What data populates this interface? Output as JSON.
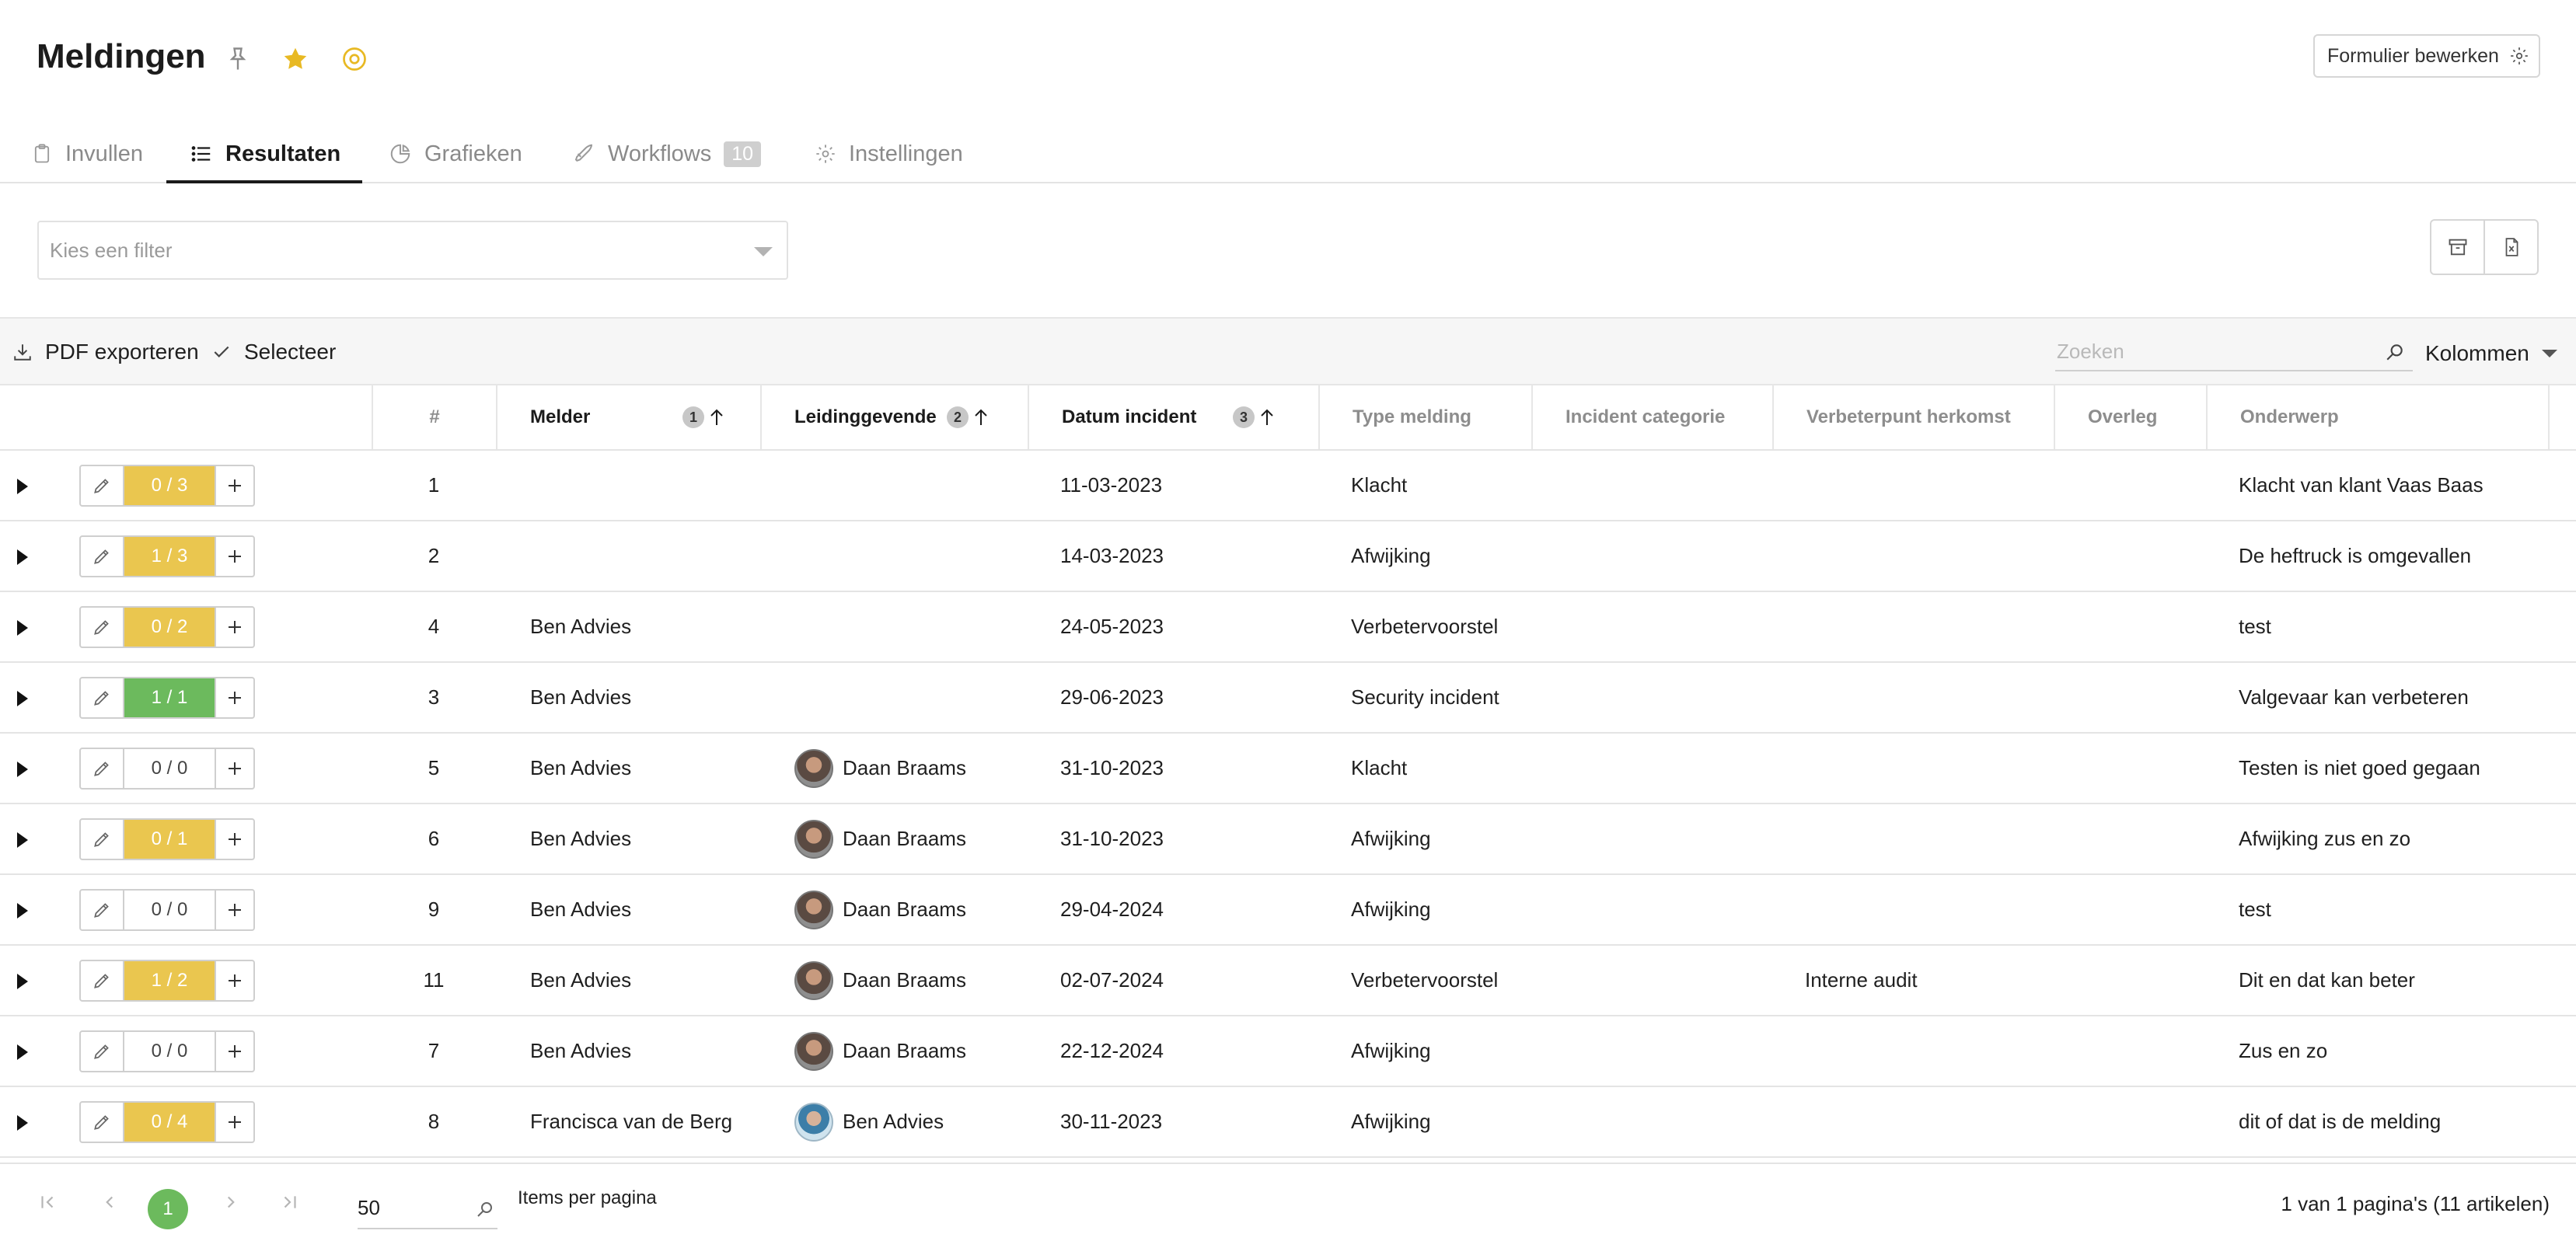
{
  "header": {
    "title": "Meldingen",
    "edit_form_label": "Formulier bewerken"
  },
  "tabs": [
    {
      "label": "Invullen",
      "icon": "clipboard-icon"
    },
    {
      "label": "Resultaten",
      "icon": "list-icon",
      "active": true
    },
    {
      "label": "Grafieken",
      "icon": "chart-pie-icon"
    },
    {
      "label": "Workflows",
      "icon": "rocket-icon",
      "badge": "10"
    },
    {
      "label": "Instellingen",
      "icon": "gear-icon"
    }
  ],
  "filter": {
    "placeholder": "Kies een filter"
  },
  "toolbar": {
    "pdf_label": "PDF exporteren",
    "select_label": "Selecteer",
    "search_placeholder": "Zoeken",
    "columns_label": "Kolommen"
  },
  "columns": {
    "nr": "#",
    "melder": "Melder",
    "melder_sort": "1",
    "leidinggevende": "Leidinggevende",
    "leidinggevende_sort": "2",
    "datum": "Datum incident",
    "datum_sort": "3",
    "type": "Type melding",
    "categorie": "Incident categorie",
    "herkomst": "Verbeterpunt herkomst",
    "overleg": "Overleg",
    "onderwerp": "Onderwerp"
  },
  "rows": [
    {
      "progress": "0 / 3",
      "status": "yellow",
      "nr": "1",
      "melder": "",
      "leidinggevende": "",
      "datum": "11-03-2023",
      "type": "Klacht",
      "herkomst": "",
      "onderwerp": "Klacht van klant Vaas Baas"
    },
    {
      "progress": "1 / 3",
      "status": "yellow",
      "nr": "2",
      "melder": "",
      "leidinggevende": "",
      "datum": "14-03-2023",
      "type": "Afwijking",
      "herkomst": "",
      "onderwerp": "De heftruck is omgevallen"
    },
    {
      "progress": "0 / 2",
      "status": "yellow",
      "nr": "4",
      "melder": "Ben Advies",
      "leidinggevende": "",
      "datum": "24-05-2023",
      "type": "Verbetervoorstel",
      "herkomst": "",
      "onderwerp": "test"
    },
    {
      "progress": "1 / 1",
      "status": "green",
      "nr": "3",
      "melder": "Ben Advies",
      "leidinggevende": "",
      "datum": "29-06-2023",
      "type": "Security incident",
      "herkomst": "",
      "onderwerp": "Valgevaar kan verbeteren"
    },
    {
      "progress": "0 / 0",
      "status": "empty",
      "nr": "5",
      "melder": "Ben Advies",
      "leidinggevende": "Daan Braams",
      "datum": "31-10-2023",
      "type": "Klacht",
      "herkomst": "",
      "onderwerp": "Testen is niet goed gegaan"
    },
    {
      "progress": "0 / 1",
      "status": "yellow",
      "nr": "6",
      "melder": "Ben Advies",
      "leidinggevende": "Daan Braams",
      "datum": "31-10-2023",
      "type": "Afwijking",
      "herkomst": "",
      "onderwerp": "Afwijking zus en zo"
    },
    {
      "progress": "0 / 0",
      "status": "empty",
      "nr": "9",
      "melder": "Ben Advies",
      "leidinggevende": "Daan Braams",
      "datum": "29-04-2024",
      "type": "Afwijking",
      "herkomst": "",
      "onderwerp": "test"
    },
    {
      "progress": "1 / 2",
      "status": "yellow",
      "nr": "11",
      "melder": "Ben Advies",
      "leidinggevende": "Daan Braams",
      "datum": "02-07-2024",
      "type": "Verbetervoorstel",
      "herkomst": "Interne audit",
      "onderwerp": "Dit en dat kan beter"
    },
    {
      "progress": "0 / 0",
      "status": "empty",
      "nr": "7",
      "melder": "Ben Advies",
      "leidinggevende": "Daan Braams",
      "datum": "22-12-2024",
      "type": "Afwijking",
      "herkomst": "",
      "onderwerp": "Zus en zo"
    },
    {
      "progress": "0 / 4",
      "status": "yellow",
      "nr": "8",
      "melder": "Francisca van de Berg",
      "leidinggevende": "Ben Advies",
      "datum": "30-11-2023",
      "type": "Afwijking",
      "herkomst": "",
      "onderwerp": "dit of dat is de melding"
    }
  ],
  "pagination": {
    "current_page": "1",
    "per_page": "50",
    "per_page_label": "Items per pagina",
    "summary": "1 van 1 pagina's (11 artikelen)"
  },
  "colors": {
    "progress_yellow": "#eac64f",
    "progress_green": "#6cba5d",
    "star": "#e8b923"
  }
}
